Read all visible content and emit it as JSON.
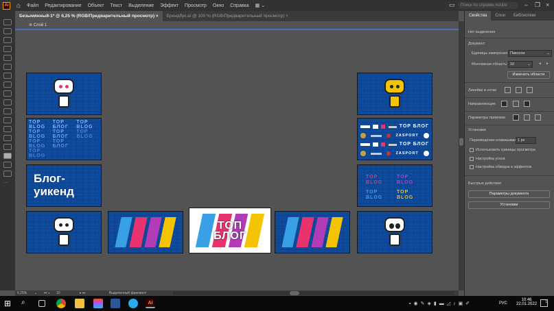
{
  "menubar": {
    "app_logo": "Ai",
    "items": [
      "Файл",
      "Редактирование",
      "Объект",
      "Текст",
      "Выделение",
      "Эффект",
      "Просмотр",
      "Окно",
      "Справка"
    ],
    "search_placeholder": "Поиск по справке Adobe"
  },
  "tabs": [
    {
      "label": "Безымянный-1* @ 6,25 % (RGB/Предварительный просмотр)",
      "close": "×"
    },
    {
      "label": "Брендбук.ai @ 100 % (RGB/Предварительный просмотр)",
      "close": "×"
    }
  ],
  "layer": {
    "name": "Слой 1"
  },
  "artboards": {
    "top_blog_pattern": [
      "TOP BLOG",
      "TOP БЛОГ",
      "TOP BLOG",
      "TOP BLOG",
      "TOP БЛОГ",
      "TOP BLOG",
      "TOP BLOG",
      "TOP БЛОГ",
      "TOP BLOG"
    ],
    "blog_weekend": "Блог-уикенд",
    "center_logo": "ТОП БЛОГ",
    "partner": "ZASPORT",
    "social": [
      "TOP BLOG",
      "TOP BLOG",
      "TOP BLOG",
      "TOP BLOG"
    ],
    "stripe_colors": [
      "#3aa0e6",
      "#e8336e",
      "#b23bb8",
      "#f5c400"
    ]
  },
  "panel": {
    "tabs": [
      "Свойства",
      "Слои",
      "Библиотеки"
    ],
    "no_selection": "Нет выделения",
    "document": "Документ",
    "units_label": "Единицы измерения:",
    "units_value": "Пиксели",
    "artboard_label": "Монтажная область:",
    "artboard_value": "10",
    "edit_artboards": "Изменить области",
    "rulers_grids": "Линейки и сетки",
    "guides": "Направляющие",
    "snap_options": "Параметры привязки",
    "preferences": "Установки",
    "keyboard_increment_label": "Перемещение клавишами:",
    "keyboard_increment_value": "1 px",
    "checkboxes": [
      "Использовать границы просмотра",
      "Настройка углов",
      "Настройка обводок и эффектов"
    ],
    "quick_actions": "Быстрые действия",
    "doc_setup": "Параметры документа",
    "prefs_button": "Установки"
  },
  "status": {
    "zoom": "6,25%",
    "artboard": "10",
    "tool": "Выделенный фрагмент"
  },
  "taskbar": {
    "lang": "РУС",
    "time": "10:46",
    "date": "22.01.2022",
    "notifications": "1"
  }
}
